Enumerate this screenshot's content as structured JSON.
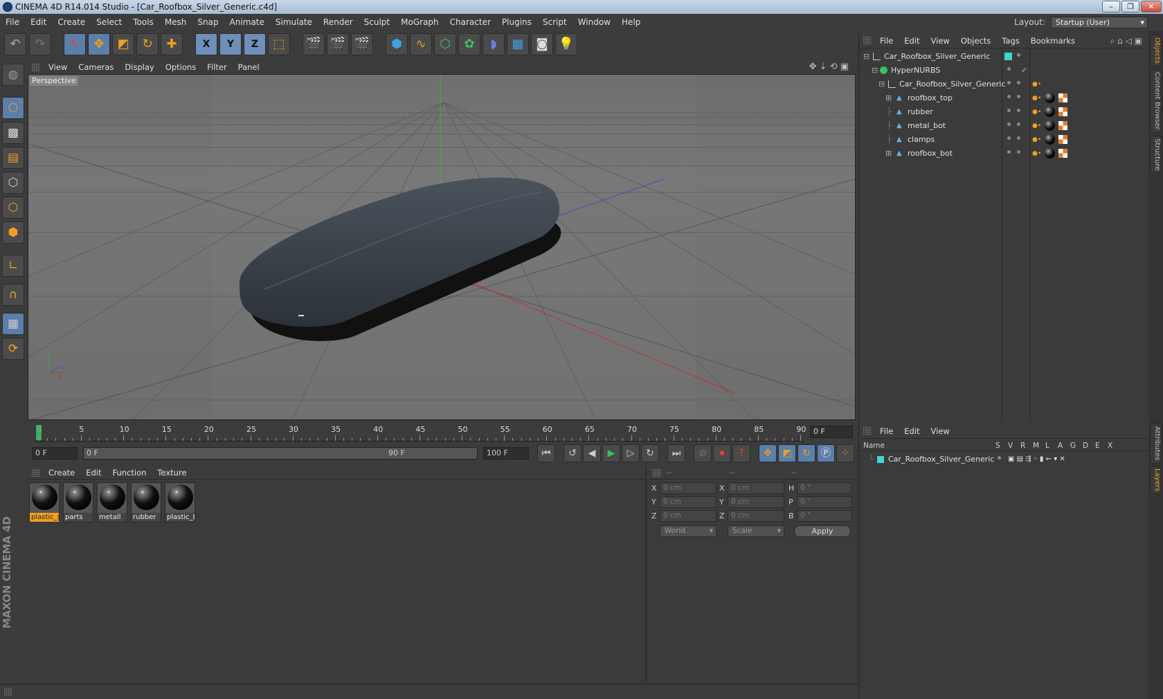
{
  "window": {
    "title": "CINEMA 4D R14.014 Studio - [Car_Roofbox_Silver_Generic.c4d]"
  },
  "menu": [
    "File",
    "Edit",
    "Create",
    "Select",
    "Tools",
    "Mesh",
    "Snap",
    "Animate",
    "Simulate",
    "Render",
    "Sculpt",
    "MoGraph",
    "Character",
    "Plugins",
    "Script",
    "Window",
    "Help"
  ],
  "layout": {
    "label": "Layout:",
    "value": "Startup (User)"
  },
  "toolbar": {
    "axis_x": "X",
    "axis_y": "Y",
    "axis_z": "Z"
  },
  "viewport": {
    "menu": [
      "View",
      "Cameras",
      "Display",
      "Options",
      "Filter",
      "Panel"
    ],
    "label": "Perspective"
  },
  "timeline": {
    "ticks": [
      "0",
      "5",
      "10",
      "15",
      "20",
      "25",
      "30",
      "35",
      "40",
      "45",
      "50",
      "55",
      "60",
      "65",
      "70",
      "75",
      "80",
      "85",
      "90"
    ],
    "current_frame": "0 F"
  },
  "transport": {
    "start": "0 F",
    "range_start": "0 F",
    "range_end": "90 F",
    "end": "100 F"
  },
  "materials": {
    "menu": [
      "Create",
      "Edit",
      "Function",
      "Texture"
    ],
    "items": [
      {
        "label": "plastic_s"
      },
      {
        "label": "parts"
      },
      {
        "label": "metall"
      },
      {
        "label": "rubber"
      },
      {
        "label": "plastic_b"
      }
    ]
  },
  "coords": {
    "headers": [
      "--",
      "--",
      "--"
    ],
    "rows": [
      {
        "a": "X",
        "av": "0 cm",
        "b": "X",
        "bv": "0 cm",
        "c": "H",
        "cv": "0 °"
      },
      {
        "a": "Y",
        "av": "0 cm",
        "b": "Y",
        "bv": "0 cm",
        "c": "P",
        "cv": "0 °"
      },
      {
        "a": "Z",
        "av": "0 cm",
        "b": "Z",
        "bv": "0 cm",
        "c": "B",
        "cv": "0 °"
      }
    ],
    "mode1": "World",
    "mode2": "Scale",
    "apply": "Apply"
  },
  "objects": {
    "menu": [
      "File",
      "Edit",
      "View",
      "Objects",
      "Tags",
      "Bookmarks"
    ],
    "items": [
      {
        "name": "Car_Roofbox_Silver_Generic"
      },
      {
        "name": "HyperNURBS"
      },
      {
        "name": "Car_Roofbox_Silver_Generic"
      },
      {
        "name": "roofbox_top"
      },
      {
        "name": "rubber"
      },
      {
        "name": "metal_bot"
      },
      {
        "name": "clamps"
      },
      {
        "name": "roofbox_bot"
      }
    ]
  },
  "layers": {
    "menu": [
      "File",
      "Edit",
      "View"
    ],
    "columns": [
      "Name",
      "S",
      "V",
      "R",
      "M",
      "L",
      "A",
      "G",
      "D",
      "E",
      "X"
    ],
    "items": [
      {
        "name": "Car_Roofbox_Silver_Generic"
      }
    ]
  },
  "right_tabs": [
    "Objects",
    "Content Browser",
    "Structure",
    "Attributes",
    "Layers"
  ],
  "branding": "MAXON CINEMA 4D"
}
